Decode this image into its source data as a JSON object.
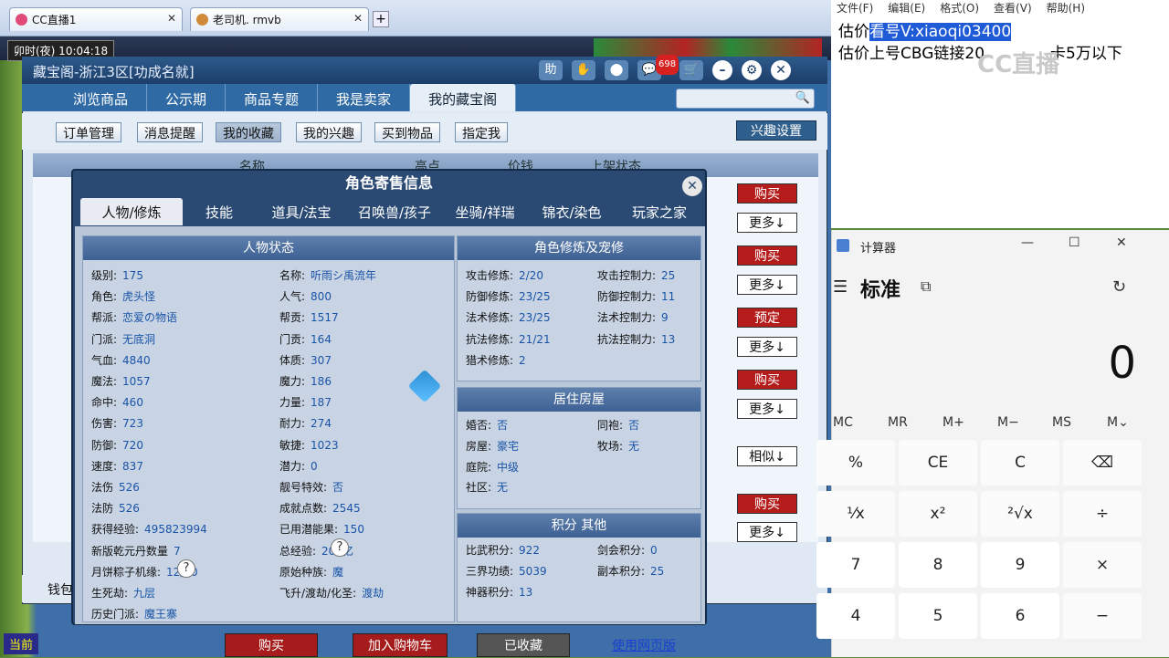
{
  "browser": {
    "tabs": [
      {
        "label": "CC直播1"
      },
      {
        "label": "老司机. rmvb"
      }
    ],
    "close": "✕",
    "new_tab": "+"
  },
  "game": {
    "clock": "卯时(夜)  10:04:18",
    "window_title": "藏宝阁-浙江3区[功成名就]",
    "top_icons": [
      "助",
      "✋",
      "⬤",
      "💬",
      "🛒"
    ],
    "message_count": "698",
    "nav_tabs": [
      "浏览商品",
      "公示期",
      "商品专题",
      "我是卖家",
      "我的藏宝阁"
    ],
    "active_nav": "我的藏宝阁",
    "sub_buttons": [
      "订单管理",
      "消息提醒",
      "我的收藏",
      "我的兴趣",
      "买到物品",
      "指定我"
    ],
    "active_sub": "我的收藏",
    "interest_button": "兴趣设置",
    "list_headers": [
      "名称",
      "高点",
      "价钱",
      "上架状态"
    ],
    "row_actions": [
      {
        "primary": "购买",
        "secondary": "更多↓"
      },
      {
        "primary": "购买",
        "secondary": "更多↓"
      },
      {
        "primary": "预定",
        "secondary": "更多↓"
      },
      {
        "primary": "购买",
        "secondary": "更多↓"
      },
      {
        "primary": "",
        "secondary": "相似↓"
      },
      {
        "primary": "购买",
        "secondary": "更多↓"
      }
    ],
    "money_label": "钱包",
    "bottom_left": "当前"
  },
  "modal": {
    "title": "角色寄售信息",
    "close": "✕",
    "tabs": [
      "人物/修炼",
      "技能",
      "道具/法宝",
      "召唤兽/孩子",
      "坐骑/祥瑞",
      "锦衣/染色",
      "玩家之家"
    ],
    "active_tab": "人物/修炼",
    "status_title": "人物状态",
    "status_left": [
      {
        "k": "级别:",
        "v": "175"
      },
      {
        "k": "角色:",
        "v": "虎头怪"
      },
      {
        "k": "帮派:",
        "v": "恋爱の物语"
      },
      {
        "k": "门派:",
        "v": "无底洞"
      },
      {
        "k": "气血:",
        "v": "4840"
      },
      {
        "k": "魔法:",
        "v": "1057"
      },
      {
        "k": "命中:",
        "v": "460"
      },
      {
        "k": "伤害:",
        "v": "723"
      },
      {
        "k": "防御:",
        "v": "720"
      },
      {
        "k": "速度:",
        "v": "837"
      },
      {
        "k": "法伤",
        "v": "526"
      },
      {
        "k": "法防",
        "v": "526"
      },
      {
        "k": "获得经验:",
        "v": "495823994"
      },
      {
        "k": "新版乾元丹数量",
        "v": "7"
      },
      {
        "k": "月饼粽子机缘:",
        "v": "12/60"
      },
      {
        "k": "生死劫:",
        "v": "九层"
      },
      {
        "k": "历史门派:",
        "v": "魔王寨"
      }
    ],
    "status_right": [
      {
        "k": "名称:",
        "v": "听雨シ禹流年"
      },
      {
        "k": "人气:",
        "v": "800"
      },
      {
        "k": "帮贡:",
        "v": "1517"
      },
      {
        "k": "门贡:",
        "v": "164"
      },
      {
        "k": "体质:",
        "v": "307"
      },
      {
        "k": "魔力:",
        "v": "186"
      },
      {
        "k": "力量:",
        "v": "187"
      },
      {
        "k": "耐力:",
        "v": "274"
      },
      {
        "k": "敏捷:",
        "v": "1023"
      },
      {
        "k": "潜力:",
        "v": "0"
      },
      {
        "k": "靓号特效:",
        "v": "否"
      },
      {
        "k": "成就点数:",
        "v": "2545"
      },
      {
        "k": "已用潜能果:",
        "v": "150"
      },
      {
        "k": "总经验:",
        "v": "208亿"
      },
      {
        "k": "原始种族:",
        "v": "魔"
      },
      {
        "k": "飞升/渡劫/化圣:",
        "v": "渡劫"
      }
    ],
    "cultivation_title": "角色修炼及宠修",
    "cultivation": [
      {
        "k": "攻击修炼:",
        "v": "2/20",
        "k2": "攻击控制力:",
        "v2": "25"
      },
      {
        "k": "防御修炼:",
        "v": "23/25",
        "k2": "防御控制力:",
        "v2": "11"
      },
      {
        "k": "法术修炼:",
        "v": "23/25",
        "k2": "法术控制力:",
        "v2": "9"
      },
      {
        "k": "抗法修炼:",
        "v": "21/21",
        "k2": "抗法控制力:",
        "v2": "13"
      },
      {
        "k": "猎术修炼:",
        "v": "2",
        "k2": "",
        "v2": ""
      }
    ],
    "house_title": "居住房屋",
    "house": [
      {
        "k": "婚否:",
        "v": "否",
        "k2": "同袍:",
        "v2": "否"
      },
      {
        "k": "房屋:",
        "v": "豪宅",
        "k2": "牧场:",
        "v2": "无"
      },
      {
        "k": "庭院:",
        "v": "中级",
        "k2": "",
        "v2": ""
      },
      {
        "k": "社区:",
        "v": "无",
        "k2": "",
        "v2": ""
      }
    ],
    "points_title": "积分 其他",
    "points": [
      {
        "k": "比武积分:",
        "v": "922",
        "k2": "剑会积分:",
        "v2": "0"
      },
      {
        "k": "三界功绩:",
        "v": "5039",
        "k2": "副本积分:",
        "v2": "25"
      },
      {
        "k": "神器积分:",
        "v": "13",
        "k2": "",
        "v2": ""
      }
    ],
    "buttons": {
      "buy": "购买",
      "cart": "加入购物车",
      "collected": "已收藏",
      "web": "使用网页版"
    }
  },
  "notepad": {
    "menu": [
      "文件(F)",
      "编辑(E)",
      "格式(O)",
      "查看(V)",
      "帮助(H)"
    ],
    "line1_prefix": "估价",
    "line1_highlight": "看号V:xiaoqi03400",
    "line2": "估价上号CBG链接20",
    "line2_tail": "卡5万以下",
    "watermark": "CC直播"
  },
  "calculator": {
    "app_title": "计算器",
    "mode": "标准",
    "display": "0",
    "memory": [
      "MC",
      "MR",
      "M+",
      "M−",
      "MS",
      "M⌄"
    ],
    "keys": [
      [
        "%",
        "CE",
        "C",
        "⌫"
      ],
      [
        "¹⁄x",
        "x²",
        "²√x",
        "÷"
      ],
      [
        "7",
        "8",
        "9",
        "×"
      ],
      [
        "4",
        "5",
        "6",
        "−"
      ]
    ],
    "window_controls": [
      "—",
      "☐",
      "✕"
    ]
  }
}
